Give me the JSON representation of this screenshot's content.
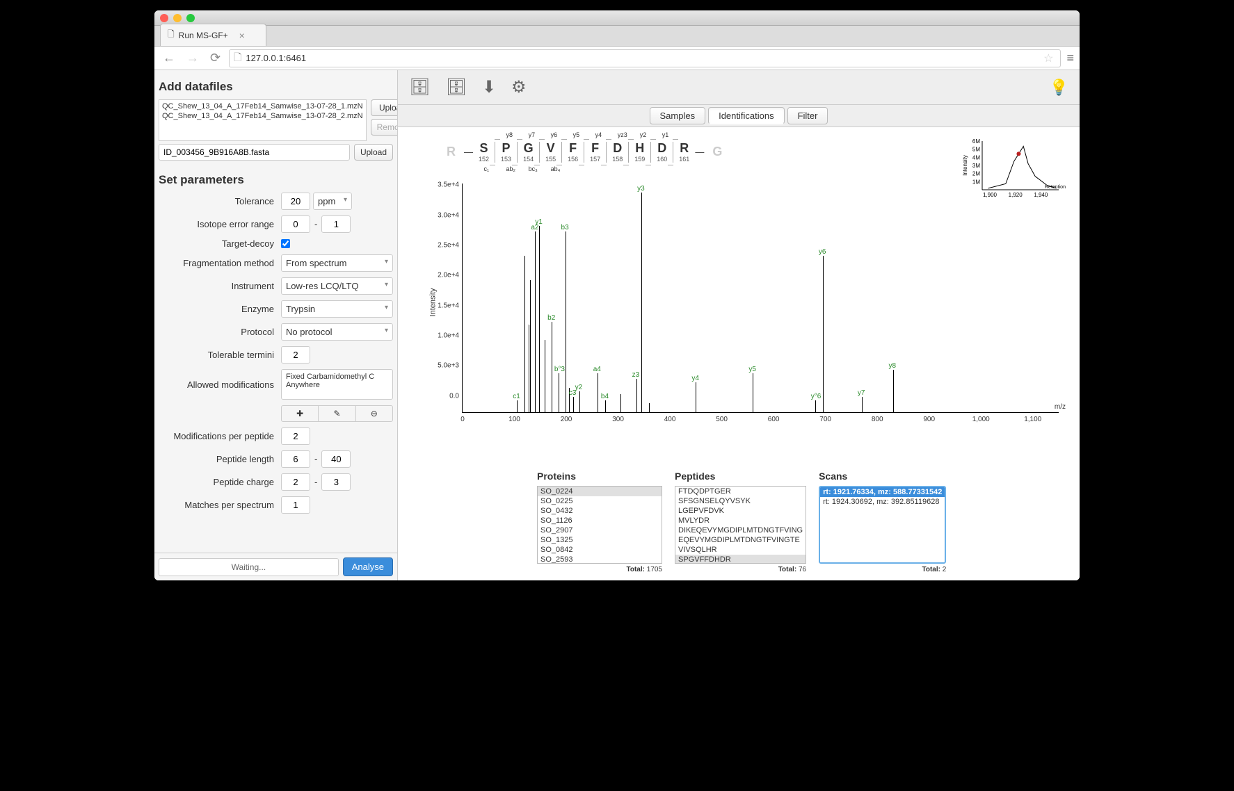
{
  "browser": {
    "tab_title": "Run MS-GF+",
    "url": "127.0.0.1:6461"
  },
  "sidebar": {
    "add_title": "Add datafiles",
    "files": [
      "QC_Shew_13_04_A_17Feb14_Samwise_13-07-28_1.mzN",
      "QC_Shew_13_04_A_17Feb14_Samwise_13-07-28_2.mzN"
    ],
    "upload": "Upload",
    "remove": "Remove",
    "fasta": "ID_003456_9B916A8B.fasta",
    "params_title": "Set parameters",
    "labels": {
      "tolerance": "Tolerance",
      "isotope": "Isotope error range",
      "target_decoy": "Target-decoy",
      "frag": "Fragmentation method",
      "instrument": "Instrument",
      "enzyme": "Enzyme",
      "protocol": "Protocol",
      "termini": "Tolerable termini",
      "mods": "Allowed modifications",
      "mods_per_pep": "Modifications per peptide",
      "pep_len": "Peptide length",
      "pep_charge": "Peptide charge",
      "matches": "Matches per spectrum"
    },
    "values": {
      "tolerance": "20",
      "tol_unit": "ppm",
      "iso_min": "0",
      "iso_max": "1",
      "frag": "From spectrum",
      "instrument": "Low-res LCQ/LTQ",
      "enzyme": "Trypsin",
      "protocol": "No protocol",
      "termini": "2",
      "mods_text": "Fixed Carbamidomethyl C Anywhere",
      "mods_per_pep": "2",
      "len_min": "6",
      "len_max": "40",
      "charge_min": "2",
      "charge_max": "3",
      "matches": "1"
    },
    "waiting": "Waiting...",
    "analyse": "Analyse"
  },
  "tabs": {
    "samples": "Samples",
    "idents": "Identifications",
    "filter": "Filter"
  },
  "peptide": {
    "nterm": "R",
    "cterm": "G",
    "residues": [
      {
        "aa": "S",
        "num": "152",
        "bot": "c₁"
      },
      {
        "aa": "P",
        "num": "153",
        "top": "y8",
        "bot": "ab₂"
      },
      {
        "aa": "G",
        "num": "154",
        "top": "y7",
        "bot": "bc₃"
      },
      {
        "aa": "V",
        "num": "155",
        "top": "y6",
        "bot": "ab₄"
      },
      {
        "aa": "F",
        "num": "156",
        "top": "y5"
      },
      {
        "aa": "F",
        "num": "157",
        "top": "y4"
      },
      {
        "aa": "D",
        "num": "158",
        "top": "yz3"
      },
      {
        "aa": "H",
        "num": "159",
        "top": "y2"
      },
      {
        "aa": "D",
        "num": "160",
        "top": "y1"
      },
      {
        "aa": "R",
        "num": "161"
      }
    ]
  },
  "chart_data": {
    "type": "bar",
    "title": "",
    "xlabel": "m/z",
    "ylabel": "Intensity",
    "xlim": [
      0,
      1150
    ],
    "ylim": [
      0,
      38000
    ],
    "yticks": [
      "0.0",
      "5.0e+3",
      "1.0e+4",
      "1.5e+4",
      "2.0e+4",
      "2.5e+4",
      "3.0e+4",
      "3.5e+4"
    ],
    "xticks": [
      0,
      100,
      200,
      300,
      400,
      500,
      600,
      700,
      800,
      900,
      1000,
      1100
    ],
    "peaks": [
      {
        "mz": 105,
        "int": 2000,
        "label": "c1"
      },
      {
        "mz": 120,
        "int": 26000
      },
      {
        "mz": 127,
        "int": 14500
      },
      {
        "mz": 130,
        "int": 22000
      },
      {
        "mz": 140,
        "int": 30000,
        "label": "a2"
      },
      {
        "mz": 148,
        "int": 31000,
        "label": "y1"
      },
      {
        "mz": 158,
        "int": 12000
      },
      {
        "mz": 172,
        "int": 15000,
        "label": "b2"
      },
      {
        "mz": 185,
        "int": 6500,
        "label": "b°3"
      },
      {
        "mz": 198,
        "int": 30000,
        "label": "b3"
      },
      {
        "mz": 205,
        "int": 4000
      },
      {
        "mz": 213,
        "int": 2500,
        "label": "c3"
      },
      {
        "mz": 225,
        "int": 3500,
        "label": "y2"
      },
      {
        "mz": 260,
        "int": 6500,
        "label": "a4"
      },
      {
        "mz": 275,
        "int": 2000,
        "label": "b4"
      },
      {
        "mz": 305,
        "int": 3000
      },
      {
        "mz": 335,
        "int": 5500,
        "label": "z3"
      },
      {
        "mz": 345,
        "int": 36500,
        "label": "y3"
      },
      {
        "mz": 360,
        "int": 1500
      },
      {
        "mz": 450,
        "int": 5000,
        "label": "y4"
      },
      {
        "mz": 560,
        "int": 6500,
        "label": "y5"
      },
      {
        "mz": 680,
        "int": 2000,
        "label": "y°6"
      },
      {
        "mz": 695,
        "int": 26000,
        "label": "y6"
      },
      {
        "mz": 770,
        "int": 2500,
        "label": "y7"
      },
      {
        "mz": 830,
        "int": 7000,
        "label": "y8"
      }
    ]
  },
  "mini_chart": {
    "xlabel": "Retention time (sec)",
    "ylabel": "Intensity",
    "xticks": [
      "1,900",
      "1,920",
      "1,940"
    ],
    "yticks": [
      "1M",
      "2M",
      "3M",
      "4M",
      "5M",
      "6M"
    ],
    "point_x": 1916,
    "point_y": 4800000,
    "xlim": [
      1885,
      1950
    ],
    "ylim": [
      0,
      6500000
    ]
  },
  "lists": {
    "proteins": {
      "title": "Proteins",
      "items": [
        "SO_0224",
        "SO_0225",
        "SO_0432",
        "SO_1126",
        "SO_2907",
        "SO_1325",
        "SO_0842",
        "SO_2593"
      ],
      "sel": 0,
      "total": "1705"
    },
    "peptides": {
      "title": "Peptides",
      "items": [
        "FTDQDPTGER",
        "SFSGNSELQYVSYK",
        "LGEPVFDVK",
        "MVLYDR",
        "DIKEQEVYMGDIPLMTDNGTFVING",
        "EQEVYMGDIPLMTDNGTFVINGTE",
        "VIVSQLHR",
        "SPGVFFDHDR"
      ],
      "sel": 7,
      "total": "76"
    },
    "scans": {
      "title": "Scans",
      "items": [
        "rt: 1921.76334, mz: 588.77331542",
        "rt: 1924.30692, mz: 392.85119628"
      ],
      "sel": 0,
      "highlight": true,
      "total": "2"
    }
  },
  "total_label": "Total:"
}
